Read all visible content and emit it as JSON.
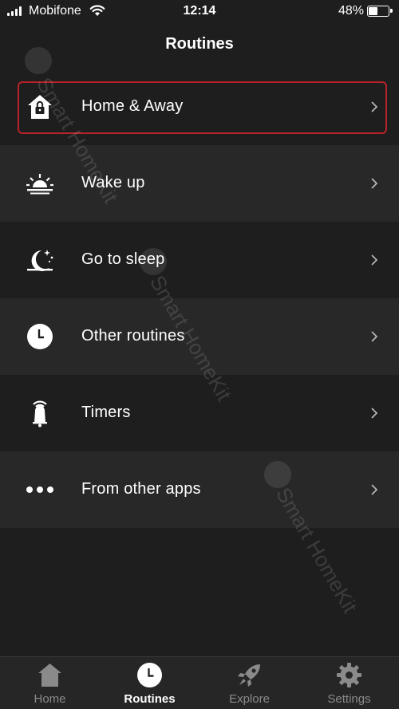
{
  "status_bar": {
    "carrier": "Mobifone",
    "time": "12:14",
    "battery_percent": "48%",
    "battery_level": 0.48
  },
  "header": {
    "title": "Routines"
  },
  "routines": [
    {
      "label": "Home & Away",
      "icon": "home-lock-icon",
      "selected": true
    },
    {
      "label": "Wake up",
      "icon": "sunrise-icon"
    },
    {
      "label": "Go to sleep",
      "icon": "moon-stars-icon"
    },
    {
      "label": "Other routines",
      "icon": "clock-icon"
    },
    {
      "label": "Timers",
      "icon": "bell-icon"
    },
    {
      "label": "From other apps",
      "icon": "more-dots-icon"
    }
  ],
  "watermark": "Smart HomeKit",
  "tabbar": {
    "tabs": [
      {
        "label": "Home",
        "icon": "home-icon"
      },
      {
        "label": "Routines",
        "icon": "clock-icon",
        "active": true
      },
      {
        "label": "Explore",
        "icon": "rocket-icon"
      },
      {
        "label": "Settings",
        "icon": "gear-icon"
      }
    ]
  },
  "colors": {
    "background": "#1e1e1e",
    "row_alt": "#282828",
    "selection_border": "#b8232b",
    "inactive_tab": "#8a8a8a"
  }
}
